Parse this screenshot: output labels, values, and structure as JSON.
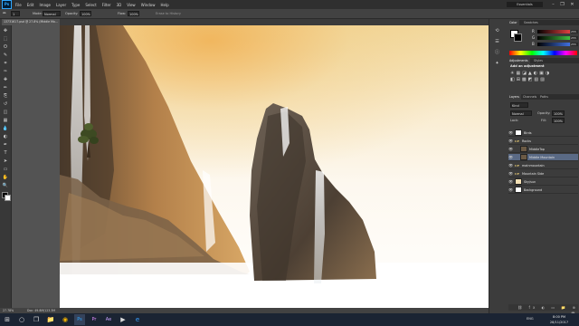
{
  "app": {
    "logo": "Ps",
    "menus": [
      "File",
      "Edit",
      "Image",
      "Layer",
      "Type",
      "Select",
      "Filter",
      "3D",
      "View",
      "Window",
      "Help"
    ],
    "workspace": "Essentials",
    "window_buttons": [
      "–",
      "❐",
      "✕"
    ]
  },
  "options": {
    "tool_icon": "brush-icon",
    "brush_size": "1",
    "mode_label": "Mode:",
    "mode_value": "Normal",
    "opacity_label": "Opacity:",
    "opacity_value": "100%",
    "flow_label": "Flow:",
    "flow_value": "100%",
    "erase_label": "Erase to History"
  },
  "document": {
    "tab_title": "13731617.psd @ 27.8% (Middle Mo...",
    "zoom": "27.78%",
    "doc_info": "Doc: 49.8M/123.3M"
  },
  "tools": [
    "move",
    "marquee",
    "lasso",
    "quick-select",
    "crop",
    "eyedropper",
    "healing",
    "brush",
    "clone",
    "history-brush",
    "eraser",
    "gradient",
    "blur",
    "dodge",
    "pen",
    "type",
    "path-select",
    "rectangle",
    "hand",
    "zoom"
  ],
  "tool_glyphs": [
    "✥",
    "⬚",
    "ʘ",
    "✎",
    "⌗",
    "✑",
    "✚",
    "✏",
    "⎘",
    "↺",
    "◫",
    "▦",
    "💧",
    "◐",
    "✒",
    "T",
    "➤",
    "▭",
    "✋",
    "🔍"
  ],
  "right_panels": {
    "color": {
      "tabs": [
        "Color",
        "Swatches"
      ],
      "channels": [
        {
          "label": "R",
          "value": "255",
          "color": "#e04040"
        },
        {
          "label": "G",
          "value": "255",
          "color": "#40c040"
        },
        {
          "label": "B",
          "value": "255",
          "color": "#4070e0"
        }
      ]
    },
    "adjustments": {
      "tabs": [
        "Adjustments",
        "Styles"
      ],
      "add_label": "Add an adjustment"
    },
    "layers": {
      "tabs": [
        "Layers",
        "Channels",
        "Paths"
      ],
      "kind_label": "Kind",
      "blend_mode": "Normal",
      "opacity_label": "Opacity:",
      "opacity_value": "100%",
      "lock_label": "Lock:",
      "fill_label": "Fill:",
      "fill_value": "100%",
      "items": [
        {
          "name": "Birds",
          "type": "layer"
        },
        {
          "name": "Rocks",
          "type": "group"
        },
        {
          "name": "MiddleTop",
          "type": "layer"
        },
        {
          "name": "Middle Mountain",
          "type": "layer",
          "selected": true
        },
        {
          "name": "mainmountain",
          "type": "group"
        },
        {
          "name": "Mountain Side",
          "type": "group"
        },
        {
          "name": "Sky/sun",
          "type": "layer"
        },
        {
          "name": "Background",
          "type": "layer"
        }
      ]
    }
  },
  "taskbar": {
    "apps": [
      "windows-start-icon",
      "search-icon",
      "task-view-icon",
      "folder-icon",
      "chrome-icon",
      "photoshop-icon",
      "premiere-icon",
      "after-effects-icon",
      "media-icon",
      "edge-icon"
    ],
    "glyphs": [
      "⊞",
      "○",
      "❐",
      "📁",
      "◉",
      "Ps",
      "Pr",
      "Ae",
      "▶",
      "e"
    ],
    "lang": "ENG",
    "time": "8:00 PM",
    "date": "28/11/2017"
  }
}
